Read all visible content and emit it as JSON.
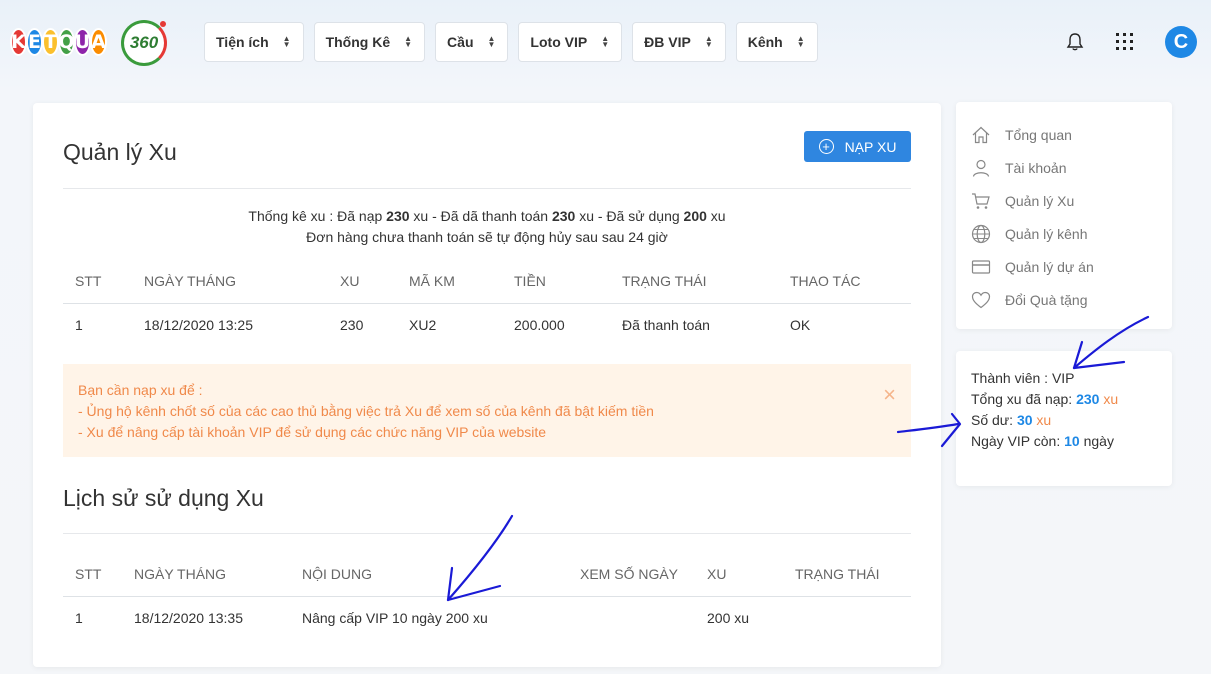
{
  "header": {
    "logo_letters": [
      "K",
      "E",
      "T",
      "Q",
      "U",
      "A"
    ],
    "logo_colors": [
      "#e53935",
      "#1e88e5",
      "#fbc02d",
      "#43a047",
      "#8e24aa",
      "#fb8c00"
    ],
    "logo_number": "360",
    "menu": [
      {
        "label": "Tiện ích"
      },
      {
        "label": "Thống Kê"
      },
      {
        "label": "Cầu"
      },
      {
        "label": "Loto VIP"
      },
      {
        "label": "ĐB VIP"
      },
      {
        "label": "Kênh"
      }
    ],
    "avatar_letter": "C"
  },
  "main": {
    "title": "Quản lý Xu",
    "nap_button": "NẠP XU",
    "stats": {
      "prefix": "Thống kê xu : Đã nạp ",
      "deposited": "230",
      "mid1": " xu - Đã dã thanh toán ",
      "paid": "230",
      "mid2": " xu - Đã sử dụng ",
      "used": "200",
      "suffix": " xu",
      "note": "Đơn hàng chưa thanh toán sẽ tự động hủy sau sau 24 giờ"
    },
    "orders": {
      "headers": [
        "STT",
        "NGÀY THÁNG",
        "XU",
        "MÃ KM",
        "TIỀN",
        "TRẠNG THÁI",
        "THAO TÁC"
      ],
      "rows": [
        [
          "1",
          "18/12/2020 13:25",
          "230",
          "XU2",
          "200.000",
          "Đã thanh toán",
          "OK"
        ]
      ]
    },
    "alert": {
      "line1": "Bạn cần nạp xu để :",
      "line2": "- Ủng hộ kênh chốt số của các cao thủ bằng việc trả Xu để xem số của kênh đã bật kiếm tiền",
      "line3": "- Xu để nâng cấp tài khoản VIP để sử dụng các chức năng VIP của website",
      "close": "×"
    },
    "history_title": "Lịch sử sử dụng Xu",
    "history": {
      "headers": [
        "STT",
        "NGÀY THÁNG",
        "NỘI DUNG",
        "XEM SỐ NGÀY",
        "XU",
        "TRẠNG THÁI"
      ],
      "rows": [
        [
          "1",
          "18/12/2020 13:35",
          "Nâng cấp VIP 10 ngày 200 xu",
          "",
          "200 xu",
          ""
        ]
      ]
    }
  },
  "sidebar": {
    "items": [
      {
        "label": "Tổng quan",
        "icon": "home-icon"
      },
      {
        "label": "Tài khoản",
        "icon": "user-icon"
      },
      {
        "label": "Quản lý Xu",
        "icon": "cart-icon"
      },
      {
        "label": "Quản lý kênh",
        "icon": "globe-icon"
      },
      {
        "label": "Quản lý dự án",
        "icon": "card-icon"
      },
      {
        "label": "Đổi Quà tặng",
        "icon": "heart-icon"
      }
    ]
  },
  "member": {
    "level_label": "Thành viên : ",
    "level": "VIP",
    "total_label": "Tổng xu đã nạp: ",
    "total": "230",
    "unit": " xu",
    "balance_label": "Số dư: ",
    "balance": "30",
    "vip_label": "Ngày VIP còn: ",
    "vip_days": "10",
    "vip_unit": " ngày"
  },
  "colors": {
    "accent": "#2f86e0",
    "alert_text": "#f0894a",
    "alert_bg": "#fff4e8",
    "annotation": "#1a1ad6"
  }
}
